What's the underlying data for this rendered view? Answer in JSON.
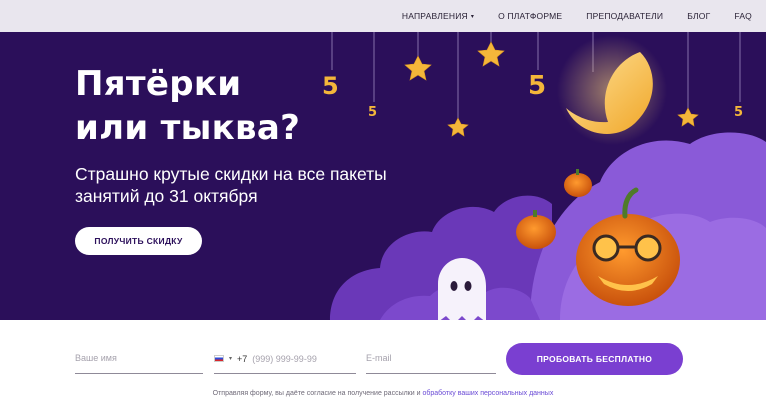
{
  "nav": {
    "items": [
      {
        "label": "НАПРАВЛЕНИЯ",
        "has_dropdown": true
      },
      {
        "label": "О ПЛАТФОРМЕ"
      },
      {
        "label": "ПРЕПОДАВАТЕЛИ"
      },
      {
        "label": "БЛОГ"
      },
      {
        "label": "FAQ"
      }
    ],
    "caret": "▾"
  },
  "hero": {
    "title_line1": "Пятёрки",
    "title_line2": "или тыква?",
    "subtitle_line1": "Страшно крутые скидки на все пакеты",
    "subtitle_line2": "занятий до 31 октября",
    "cta_label": "ПОЛУЧИТЬ СКИДКУ",
    "decor_number": "5"
  },
  "form": {
    "name_placeholder": "Ваше имя",
    "phone_code": "+7",
    "phone_placeholder": "(999) 999-99-99",
    "email_placeholder": "E-mail",
    "submit_label": "ПРОБОВАТЬ БЕСПЛАТНО",
    "consent_text": "Отправляя форму, вы даёте согласие на получение рассылки и",
    "consent_link": "обработку ваших персональных данных"
  },
  "colors": {
    "hero_bg": "#2b0f5a",
    "accent": "#7a3fd1",
    "cloud": "#8a5ad8",
    "star": "#f4b63a"
  }
}
